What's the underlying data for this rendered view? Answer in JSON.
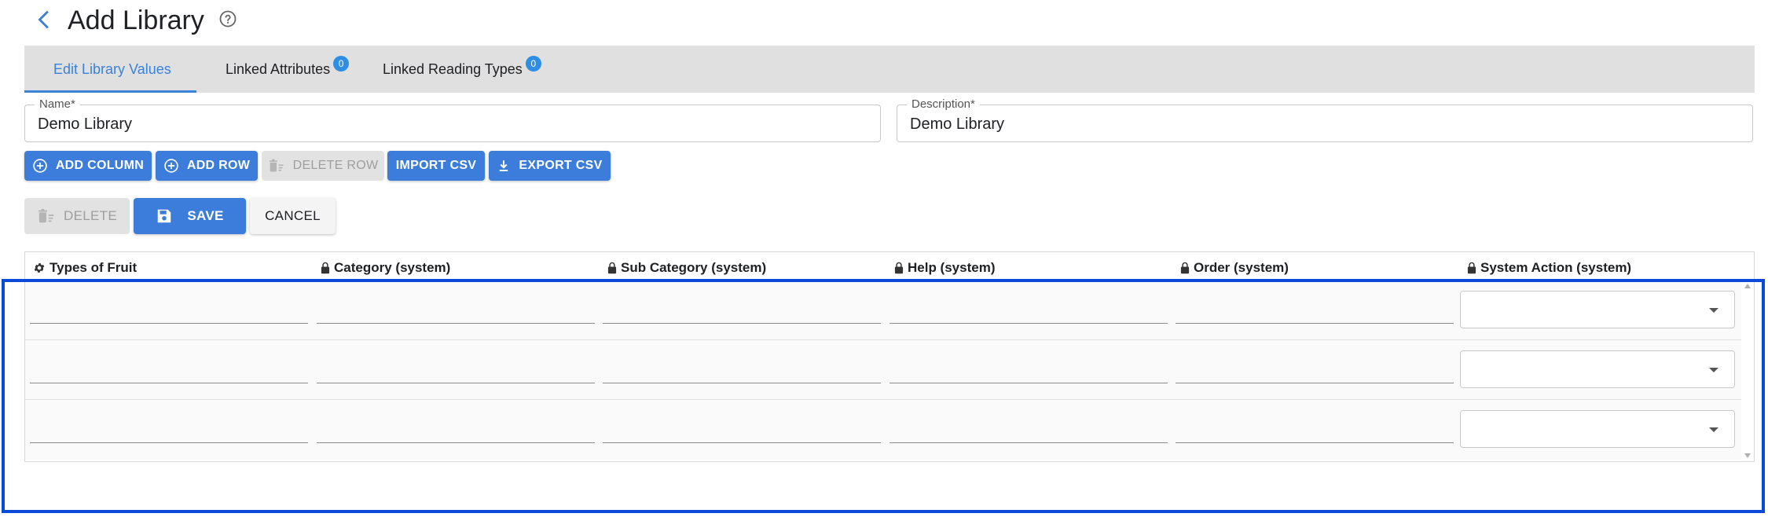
{
  "header": {
    "title": "Add Library"
  },
  "tabs": [
    {
      "label": "Edit Library Values",
      "active": true
    },
    {
      "label": "Linked Attributes",
      "badge": "0"
    },
    {
      "label": "Linked Reading Types",
      "badge": "0"
    }
  ],
  "form": {
    "name_label": "Name*",
    "name_value": "Demo Library",
    "description_label": "Description*",
    "description_value": "Demo Library"
  },
  "toolbar": {
    "add_column": "ADD COLUMN",
    "add_row": "ADD ROW",
    "delete_row": "DELETE ROW",
    "import_csv": "IMPORT CSV",
    "export_csv": "EXPORT CSV"
  },
  "actions": {
    "delete": "DELETE",
    "save": "SAVE",
    "cancel": "CANCEL"
  },
  "table": {
    "columns": [
      {
        "label": "Types of Fruit",
        "icon": "gear-icon"
      },
      {
        "label": "Category (system)",
        "icon": "lock-icon"
      },
      {
        "label": "Sub Category (system)",
        "icon": "lock-icon"
      },
      {
        "label": "Help (system)",
        "icon": "lock-icon"
      },
      {
        "label": "Order (system)",
        "icon": "lock-icon"
      },
      {
        "label": "System Action (system)",
        "icon": "lock-icon"
      }
    ],
    "row_count": 3
  },
  "colors": {
    "primary": "#3c7ddb",
    "tab_active": "#3b82d9",
    "badge": "#2f8de4",
    "highlight": "#0a4ad8"
  }
}
